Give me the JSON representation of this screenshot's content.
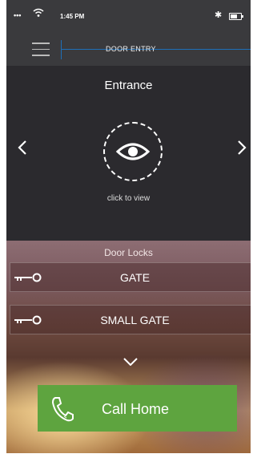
{
  "status": {
    "dots": "•••",
    "time": "1:45 PM"
  },
  "header": {
    "title": "DOOR ENTRY"
  },
  "camera": {
    "name": "Entrance",
    "hint": "click to view"
  },
  "locks": {
    "title": "Door Locks",
    "items": [
      {
        "label": "GATE"
      },
      {
        "label": "SMALL GATE"
      }
    ]
  },
  "call": {
    "label": "Call Home"
  },
  "icons": {
    "menu": "hamburger-icon",
    "view": "eye-icon",
    "prev": "chevron-left-icon",
    "next": "chevron-right-icon",
    "key": "key-icon",
    "more": "chevron-down-icon",
    "call": "phone-icon",
    "wifi": "wifi-icon",
    "bluetooth": "bluetooth-icon",
    "battery": "battery-icon"
  },
  "colors": {
    "accent": "#1e6fb8",
    "call": "#5ea43f",
    "bar": "#3a3a3d"
  }
}
